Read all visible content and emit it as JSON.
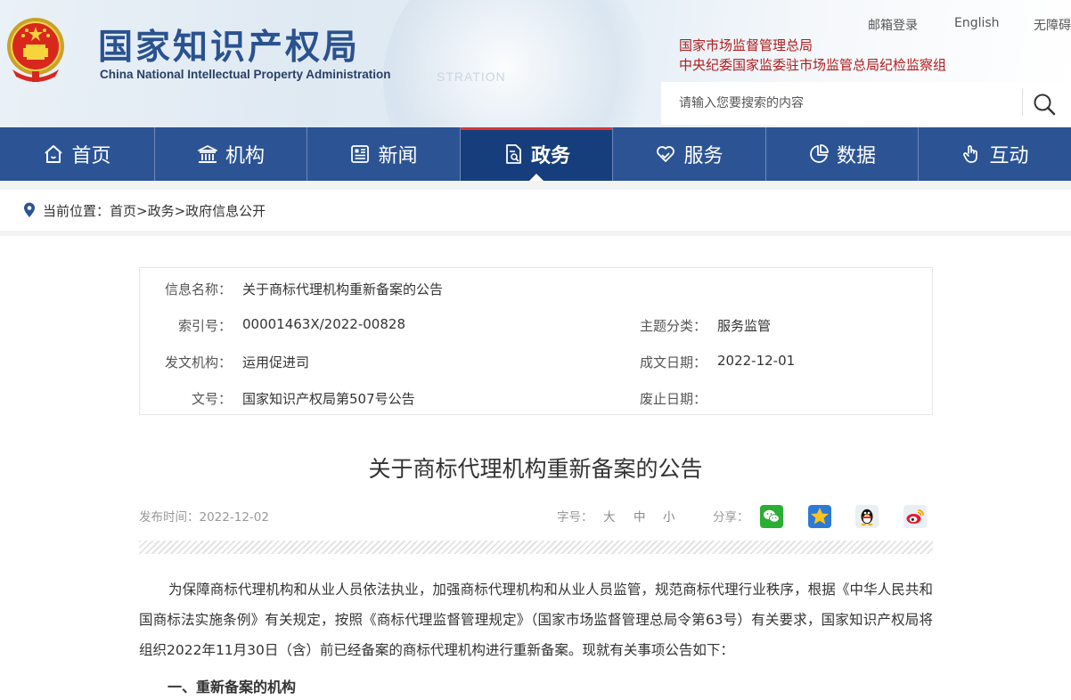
{
  "header": {
    "logo_cn": "国家知识产权局",
    "logo_en": "China National Intellectual Property Administration",
    "watermark": "STRATION",
    "links": [
      "邮箱登录",
      "English",
      "无障碍"
    ],
    "agency1": "国家市场监督管理总局",
    "agency2": "中央纪委国家监委驻市场监管总局纪检监察组",
    "search_placeholder": "请输入您要搜索的内容"
  },
  "nav": {
    "items": [
      {
        "label": "首页",
        "icon": "home-icon"
      },
      {
        "label": "机构",
        "icon": "institution-icon"
      },
      {
        "label": "新闻",
        "icon": "news-icon"
      },
      {
        "label": "政务",
        "icon": "government-affairs-icon"
      },
      {
        "label": "服务",
        "icon": "service-icon"
      },
      {
        "label": "数据",
        "icon": "data-chart-icon"
      },
      {
        "label": "互动",
        "icon": "interaction-hand-icon"
      }
    ],
    "active_index": 3
  },
  "breadcrumb": {
    "text": "当前位置：首页>政务>政府信息公开"
  },
  "info": {
    "name_label": "信息名称：",
    "name_value": "关于商标代理机构重新备案的公告",
    "index_label": "索引号：",
    "index_value": "00001463X/2022-00828",
    "topic_label": "主题分类：",
    "topic_value": "服务监管",
    "issuer_label": "发文机构：",
    "issuer_value": "运用促进司",
    "date_label": "成文日期：",
    "date_value": "2022-12-01",
    "docno_label": "文号：",
    "docno_value": "国家知识产权局第507号公告",
    "expiry_label": "废止日期：",
    "expiry_value": ""
  },
  "article": {
    "title": "关于商标代理机构重新备案的公告",
    "publish": "发布时间：2022-12-02",
    "font_label": "字号：",
    "font_large": "大",
    "font_medium": "中",
    "font_small": "小",
    "share_label": "分享：",
    "paragraph1": "为保障商标代理机构和从业人员依法执业，加强商标代理机构和从业人员监管，规范商标代理行业秩序，根据《中华人民共和国商标法实施条例》有关规定，按照《商标代理监督管理规定》（国家市场监督管理总局令第63号）有关要求，国家知识产权局将组织2022年11月30日（含）前已经备案的商标代理机构进行重新备案。现就有关事项公告如下：",
    "section1": "一、重新备案的机构"
  },
  "colors": {
    "nav_bg": "#2c5495",
    "nav_active": "#173e7c",
    "logo_blue": "#2a5290",
    "agency_red": "#b01c1c"
  }
}
